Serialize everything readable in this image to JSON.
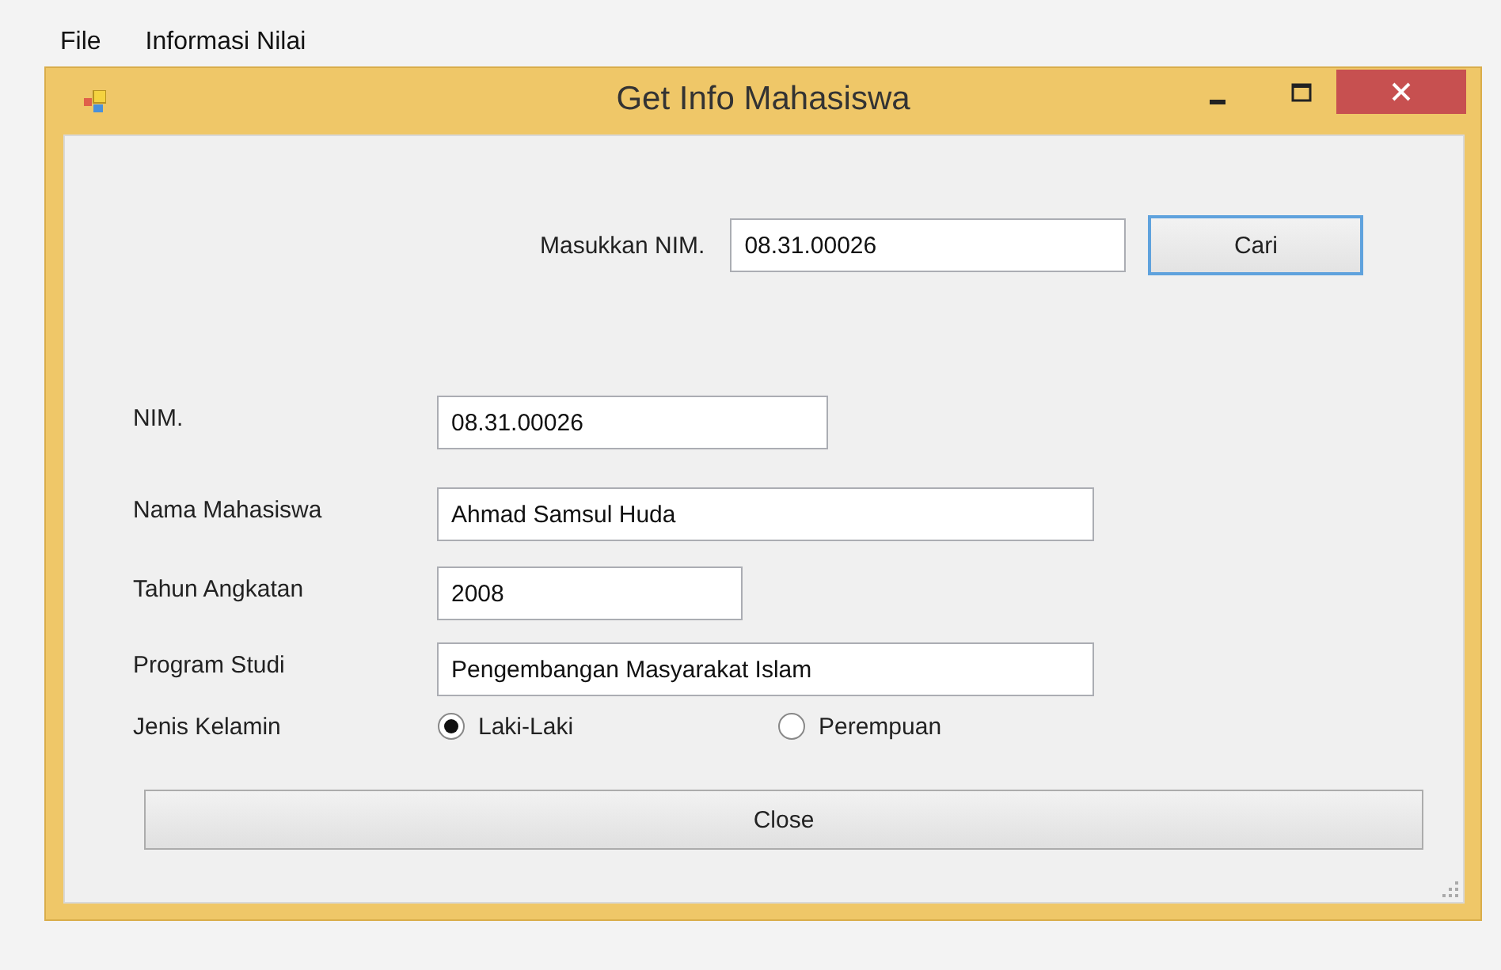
{
  "menu": [
    {
      "label": "File"
    },
    {
      "label": "Informasi Nilai"
    }
  ],
  "window": {
    "title": "Get Info Mahasiswa"
  },
  "search": {
    "label": "Masukkan NIM.",
    "value": "08.31.00026",
    "button": "Cari"
  },
  "fields": [
    {
      "label": "NIM.",
      "value": "08.31.00026"
    },
    {
      "label": "Nama Mahasiswa",
      "value": "Ahmad Samsul Huda"
    },
    {
      "label": "Tahun Angkatan",
      "value": "2008"
    },
    {
      "label": "Program Studi",
      "value": "Pengembangan Masyarakat Islam"
    }
  ],
  "gender": {
    "label": "Jenis Kelamin",
    "options": [
      {
        "label": "Laki-Laki",
        "selected": true
      },
      {
        "label": "Perempuan",
        "selected": false
      }
    ]
  },
  "close_button": "Close"
}
